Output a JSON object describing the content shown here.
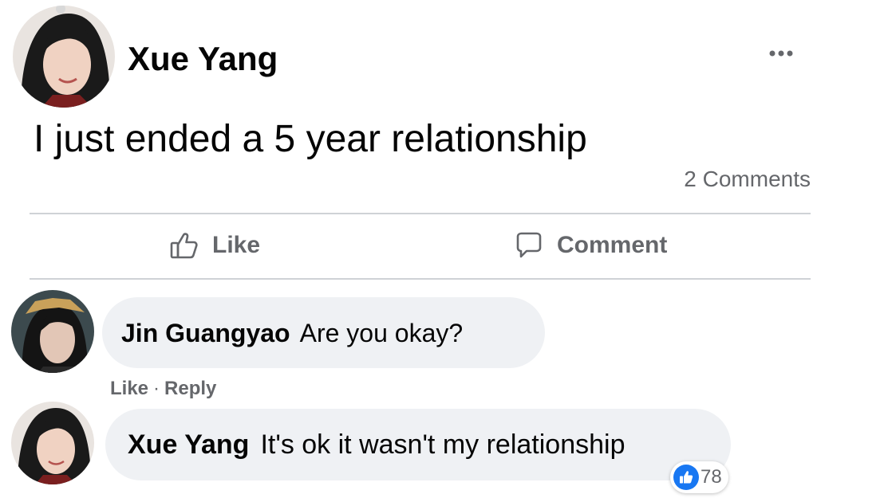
{
  "post": {
    "author": "Xue Yang",
    "avatar_icon": "user-avatar-xue-yang",
    "text": "I just ended a 5 year relationship",
    "comments_count": "2 Comments",
    "more_icon": "more-options-icon"
  },
  "actions": {
    "like_label": "Like",
    "comment_label": "Comment"
  },
  "comments": [
    {
      "author": "Jin Guangyao",
      "text": "Are you okay?",
      "like_label": "Like",
      "separator": "·",
      "reply_label": "Reply"
    },
    {
      "author": "Xue Yang",
      "text": "It's ok it wasn't my relationship",
      "reaction_count": "78"
    }
  ],
  "colors": {
    "secondary_text": "#65676b",
    "bubble_bg": "#eff1f4",
    "like_blue": "#1877f2",
    "divider": "#cfd2d6"
  }
}
